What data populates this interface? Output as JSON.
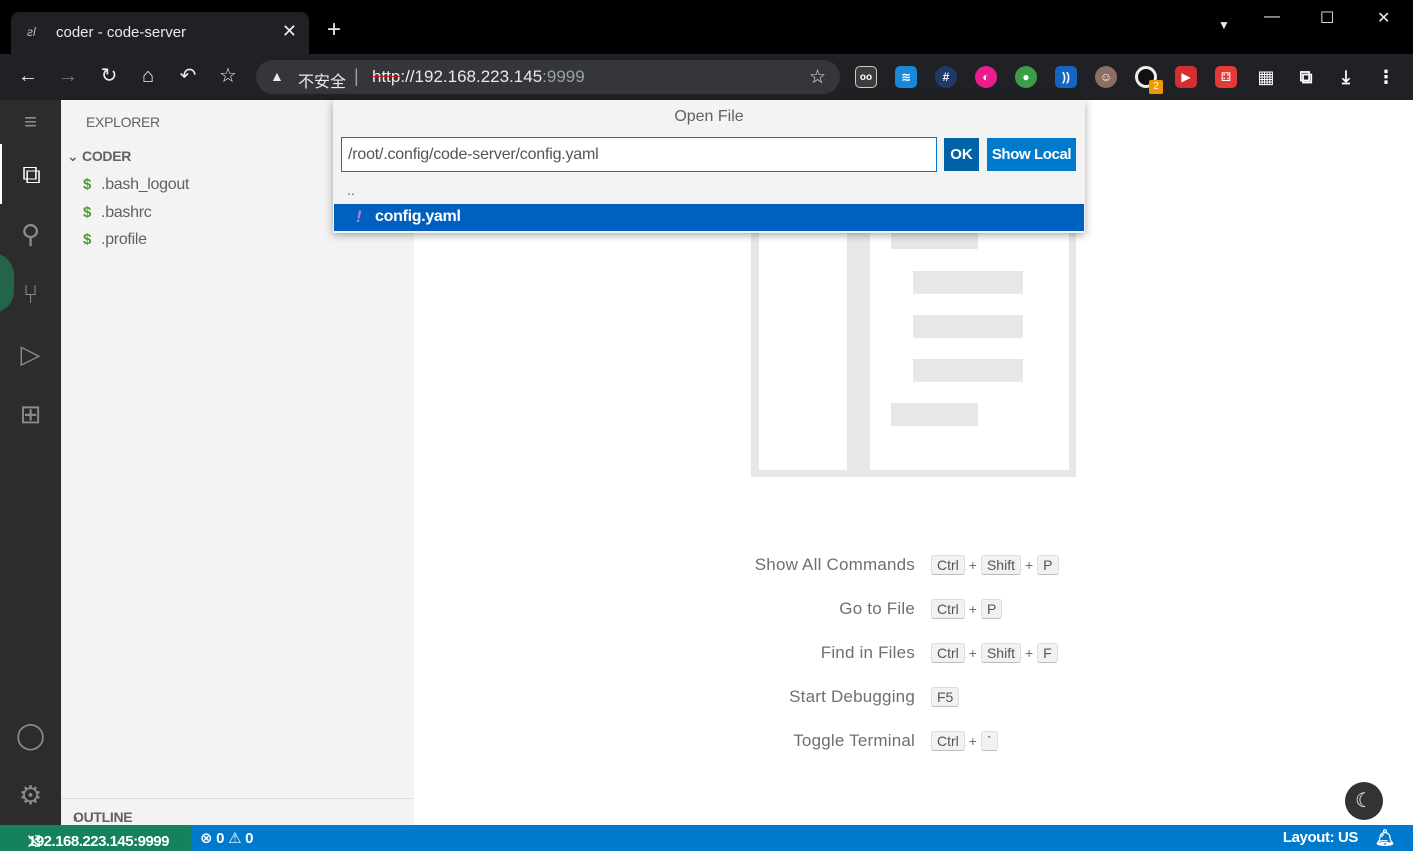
{
  "browser": {
    "tab_title": "coder - code-server",
    "tab_close": "✕",
    "new_tab": "+",
    "window_buttons": [
      "—",
      "☐",
      "✕"
    ],
    "security_label": "不安全",
    "url_scheme": "http",
    "url_host": "://192.168.223.145",
    "url_port": ":9999",
    "extension_badge": "2"
  },
  "activity_bar": {
    "items": [
      "explorer-icon",
      "search-icon",
      "source-control-icon",
      "run-debug-icon",
      "extensions-icon"
    ],
    "bottom": [
      "account-icon",
      "settings-gear-icon"
    ]
  },
  "sidebar": {
    "header": "EXPLORER",
    "folder": "CODER",
    "files": [
      ".bash_logout",
      ".bashrc",
      ".profile"
    ],
    "outline": "OUTLINE"
  },
  "dialog": {
    "title": "Open File",
    "path_value": "/root/.config/code-server/config.yaml",
    "ok_label": "OK",
    "show_local_label": "Show Local",
    "parent_entry": "..",
    "selected_file": "config.yaml"
  },
  "shortcuts": [
    {
      "label": "Show All Commands",
      "keys": [
        "Ctrl",
        "Shift",
        "P"
      ]
    },
    {
      "label": "Go to File",
      "keys": [
        "Ctrl",
        "P"
      ]
    },
    {
      "label": "Find in Files",
      "keys": [
        "Ctrl",
        "Shift",
        "F"
      ]
    },
    {
      "label": "Start Debugging",
      "keys": [
        "F5"
      ]
    },
    {
      "label": "Toggle Terminal",
      "keys": [
        "Ctrl",
        "`"
      ]
    }
  ],
  "statusbar": {
    "remote": "192.168.223.145:9999",
    "errors": "0",
    "warnings": "0",
    "layout": "Layout: US"
  },
  "colors": {
    "statusbar": "#007acc",
    "remote": "#16825d",
    "selection": "#0060c0"
  }
}
